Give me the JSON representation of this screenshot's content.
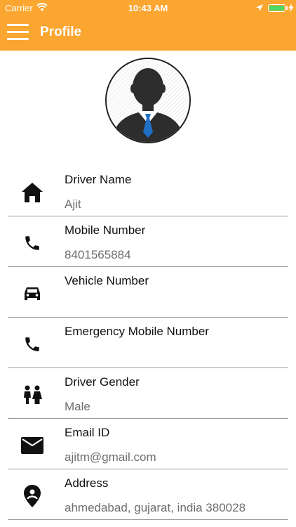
{
  "status_bar": {
    "carrier": "Carrier",
    "time": "10:43 AM",
    "battery_color": "#4cd964"
  },
  "nav": {
    "title": "Profile",
    "menu_icon": "hamburger-icon",
    "background": "#fba630"
  },
  "avatar": {
    "icon": "person-avatar-icon"
  },
  "fields": [
    {
      "icon": "home-icon",
      "label": "Driver Name",
      "value": "Ajit"
    },
    {
      "icon": "phone-icon",
      "label": "Mobile Number",
      "value": "8401565884"
    },
    {
      "icon": "car-icon",
      "label": "Vehicle Number",
      "value": ""
    },
    {
      "icon": "phone-icon",
      "label": "Emergency Mobile Number",
      "value": ""
    },
    {
      "icon": "gender-icon",
      "label": "Driver Gender",
      "value": "Male"
    },
    {
      "icon": "email-icon",
      "label": "Email ID",
      "value": "ajitm@gmail.com"
    },
    {
      "icon": "location-pin-icon",
      "label": "Address",
      "value": "ahmedabad, gujarat, india 380028"
    }
  ]
}
